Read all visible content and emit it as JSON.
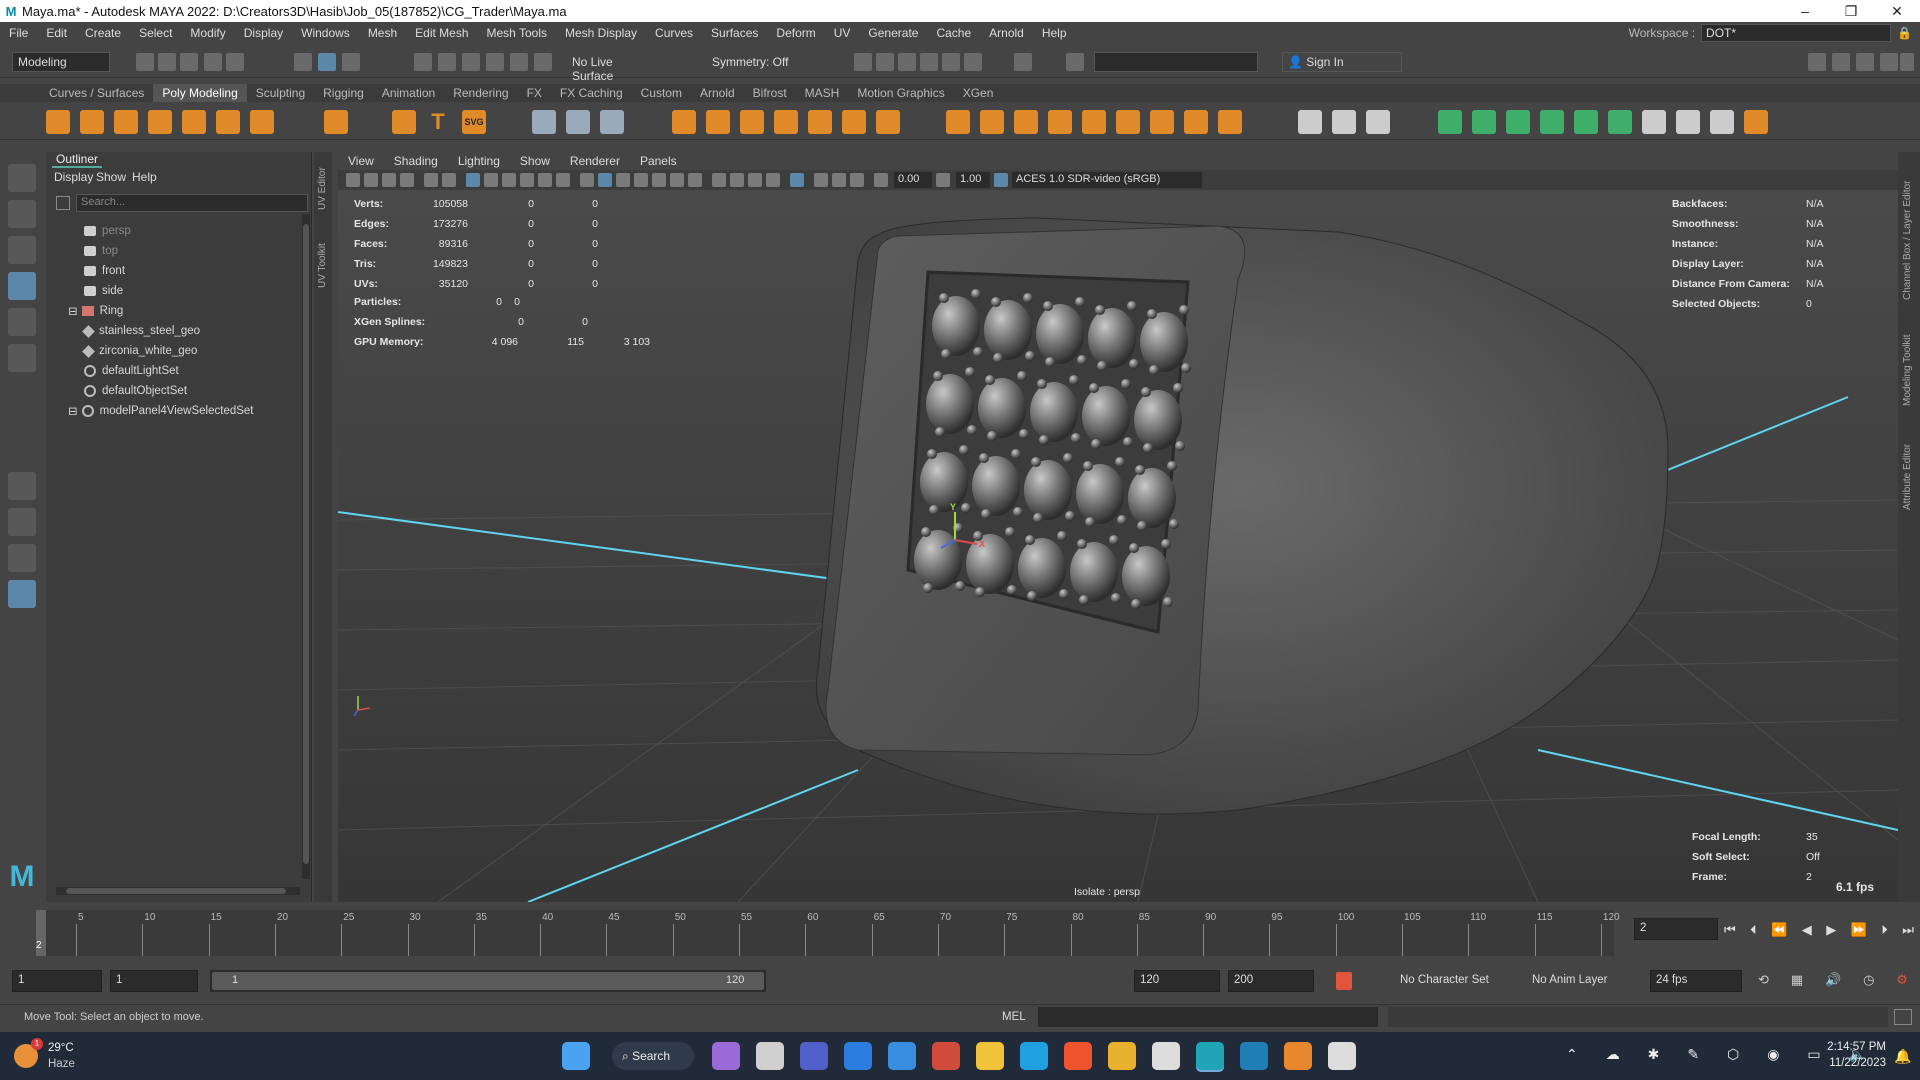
{
  "window": {
    "title": "Maya.ma* - Autodesk MAYA 2022: D:\\Creators3D\\Hasib\\Job_05(187852)\\CG_Trader\\Maya.ma",
    "logo": "M"
  },
  "menu": [
    "File",
    "Edit",
    "Create",
    "Select",
    "Modify",
    "Display",
    "Windows",
    "Mesh",
    "Edit Mesh",
    "Mesh Tools",
    "Mesh Display",
    "Curves",
    "Surfaces",
    "Deform",
    "UV",
    "Generate",
    "Cache",
    "Arnold",
    "Help"
  ],
  "workspace": {
    "label": "Workspace :",
    "value": "DOT*"
  },
  "statusline": {
    "mode": "Modeling",
    "live_surface": "No Live Surface",
    "symmetry": "Symmetry: Off",
    "sign_in": "Sign In"
  },
  "shelf_tabs": [
    "Curves / Surfaces",
    "Poly Modeling",
    "Sculpting",
    "Rigging",
    "Animation",
    "Rendering",
    "FX",
    "FX Caching",
    "Custom",
    "Arnold",
    "Bifrost",
    "MASH",
    "Motion Graphics",
    "XGen"
  ],
  "shelf_active": "Poly Modeling",
  "shelf_svg_label": "SVG",
  "outliner": {
    "title": "Outliner",
    "menu": [
      "Display",
      "Show",
      "Help"
    ],
    "search_placeholder": "Search...",
    "items": [
      {
        "label": "persp",
        "icon": "camera-icon",
        "dim": true
      },
      {
        "label": "top",
        "icon": "camera-icon",
        "dim": true
      },
      {
        "label": "front",
        "icon": "camera-icon",
        "dim": false
      },
      {
        "label": "side",
        "icon": "camera-icon",
        "dim": false
      },
      {
        "label": "Ring",
        "icon": "group-icon",
        "dim": false
      },
      {
        "label": "stainless_steel_geo",
        "icon": "mesh-icon",
        "dim": false
      },
      {
        "label": "zirconia_white_geo",
        "icon": "mesh-icon",
        "dim": false
      },
      {
        "label": "defaultLightSet",
        "icon": "set-icon",
        "dim": false
      },
      {
        "label": "defaultObjectSet",
        "icon": "set-icon",
        "dim": false
      },
      {
        "label": "modelPanel4ViewSelectedSet",
        "icon": "set-icon",
        "dim": false
      }
    ]
  },
  "side_tabs": [
    "UV Editor",
    "UV Toolkit"
  ],
  "right_tabs": [
    "Channel Box / Layer Editor",
    "Modeling Toolkit",
    "Attribute Editor"
  ],
  "viewport_menu": [
    "View",
    "Shading",
    "Lighting",
    "Show",
    "Renderer",
    "Panels"
  ],
  "viewport_toolbar": {
    "exposure": "0.00",
    "gamma": "1.00",
    "color_space": "ACES 1.0 SDR-video (sRGB)"
  },
  "hud_left": [
    {
      "label": "Verts:",
      "v1": "105058",
      "v2": "0",
      "v3": "0"
    },
    {
      "label": "Edges:",
      "v1": "173276",
      "v2": "0",
      "v3": "0"
    },
    {
      "label": "Faces:",
      "v1": "89316",
      "v2": "0",
      "v3": "0"
    },
    {
      "label": "Tris:",
      "v1": "149823",
      "v2": "0",
      "v3": "0"
    },
    {
      "label": "UVs:",
      "v1": "35120",
      "v2": "0",
      "v3": "0"
    }
  ],
  "hud_particles": {
    "label": "Particles:",
    "v1": "0",
    "v2": "0"
  },
  "hud_xgen": {
    "label": "XGen Splines:",
    "v1": "0",
    "v2": "0"
  },
  "hud_gpu": {
    "label": "GPU Memory:",
    "v1": "4 096",
    "v2": "115",
    "v3": "3 103"
  },
  "hud_right": [
    {
      "label": "Backfaces:",
      "value": "N/A"
    },
    {
      "label": "Smoothness:",
      "value": "N/A"
    },
    {
      "label": "Instance:",
      "value": "N/A"
    },
    {
      "label": "Display Layer:",
      "value": "N/A"
    },
    {
      "label": "Distance From Camera:",
      "value": "N/A"
    },
    {
      "label": "Selected Objects:",
      "value": "0"
    }
  ],
  "hud_bottom_right": [
    {
      "label": "Focal Length:",
      "value": "35"
    },
    {
      "label": "Soft Select:",
      "value": "Off"
    },
    {
      "label": "Frame:",
      "value": "2"
    }
  ],
  "fps": "6.1 fps",
  "isolate_label": "Isolate : persp",
  "gizmo": {
    "y": "Y",
    "x": "X"
  },
  "timeline": {
    "ticks": [
      "5",
      "10",
      "15",
      "20",
      "25",
      "30",
      "35",
      "40",
      "45",
      "50",
      "55",
      "60",
      "65",
      "70",
      "75",
      "80",
      "85",
      "90",
      "95",
      "100",
      "105",
      "110",
      "115",
      "120"
    ],
    "current": "2",
    "current_field": "2"
  },
  "range": {
    "start": "1",
    "start2": "1",
    "slider_start": "1",
    "slider_end": "120",
    "end": "120",
    "end2": "200",
    "character_set": "No Character Set",
    "anim_layer": "No Anim Layer",
    "fps": "24 fps"
  },
  "helpline": {
    "text": "Move Tool: Select an object to move.",
    "mel": "MEL"
  },
  "taskbar": {
    "temp": "29°C",
    "weather": "Haze",
    "search": "Search",
    "time": "2:14:57 PM",
    "date": "11/22/2023",
    "badge": "1"
  },
  "colors": {
    "accent": "#5fa8d3",
    "active_tool": "#5b87a8",
    "grid_axis": "#5fd5f0"
  }
}
